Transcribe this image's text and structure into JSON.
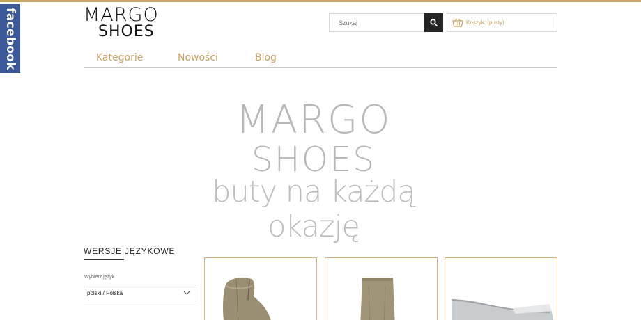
{
  "social": {
    "facebook_label": "facebook"
  },
  "logo": {
    "line1": "MARGO",
    "line2": "SHOES"
  },
  "search": {
    "placeholder": "Szukaj",
    "button_icon": "search-icon"
  },
  "cart": {
    "label": "Koszyk: (pusty)",
    "icon": "basket-icon"
  },
  "nav": {
    "items": [
      {
        "label": "Kategorie"
      },
      {
        "label": "Nowości"
      },
      {
        "label": "Blog"
      }
    ]
  },
  "banner": {
    "line1": "MARGO",
    "line2": "SHOES",
    "tagline": "buty na każdą okazję"
  },
  "language": {
    "title": "Wersje językowe",
    "select_label": "Wybierz język",
    "selected": "polski / Polska"
  },
  "products": [
    {
      "image": "suede-ankle-boot",
      "color": "#9a8f72"
    },
    {
      "image": "tall-boot",
      "color": "#a09577"
    },
    {
      "image": "silver-loafer",
      "color": "#c9ccce"
    }
  ],
  "colors": {
    "accent": "#c8a468",
    "facebook": "#3b5998",
    "dark": "#252525"
  }
}
